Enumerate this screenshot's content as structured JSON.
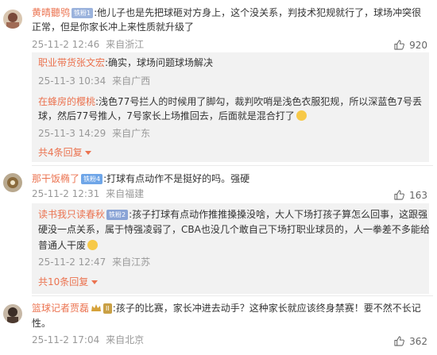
{
  "comments": [
    {
      "user": "黄晴聽鸮",
      "badge": "铁粉1",
      "text_line1": ":他儿子也是先把球砸对方身上，这个没关系，判技术犯规就行了，球场冲突很",
      "text_line2": "正常，但是你家长冲上来性质就升级了",
      "time": "25-11-2 12:46",
      "location": "来自浙江",
      "likes": "920",
      "replies": [
        {
          "user": "职业带货张文宏",
          "text": ":确实，球场问题球场解决",
          "time": "25-11-3 10:34",
          "location": "来自广西"
        },
        {
          "user": "在蜂房的樱桃",
          "text_line1": ":浅色77号拦人的时候用了脚勾，裁判吹哨是浅色衣服犯规，所以深蓝色7号丢",
          "text_line2": "球，然后77号推人，7号家长上场推回去，后面就是混合打了",
          "time": "25-11-3 14:29",
          "location": "来自广东"
        }
      ],
      "more_replies": "共4条回复"
    },
    {
      "user": "那干饭椭了",
      "badge": "铁粉4",
      "text_line1": ":打球有点动作不是挺好的吗。强硬",
      "time": "25-11-2 12:31",
      "location": "来自福建",
      "likes": "163",
      "replies": [
        {
          "user": "读书我只读春秋",
          "badge": "铁粉2",
          "text_line1": ":孩子打球有点动作推推搡搡没啥，大人下场打孩子算怎么回事，这跟强",
          "text_line2": "硬没一点关系，属于恃强凌弱了，CBA也没几个敢自己下场打职业球员的，人一拳差不多能给",
          "text_line3": "普通人干废",
          "time": "25-11-2 12:47",
          "location": "来自江苏"
        }
      ],
      "more_replies": "共10条回复"
    },
    {
      "user": "篮球记者贾磊",
      "badge": "II",
      "text_line1": ":孩子的比赛，家长冲进去动手？这种家长就应该终身禁赛！要不然不长记",
      "text_line2": "性。",
      "time": "25-11-2 17:04",
      "location": "来自北京",
      "likes": "362"
    }
  ],
  "icons": {
    "like": "thumbs-up-icon",
    "expand": "chevron-down-icon",
    "emoji": "smiley-emoji-icon",
    "crown": "crown-icon"
  },
  "colors": {
    "username": "#eb7350",
    "meta": "#999999",
    "reply_bg": "#f2f2f2"
  }
}
